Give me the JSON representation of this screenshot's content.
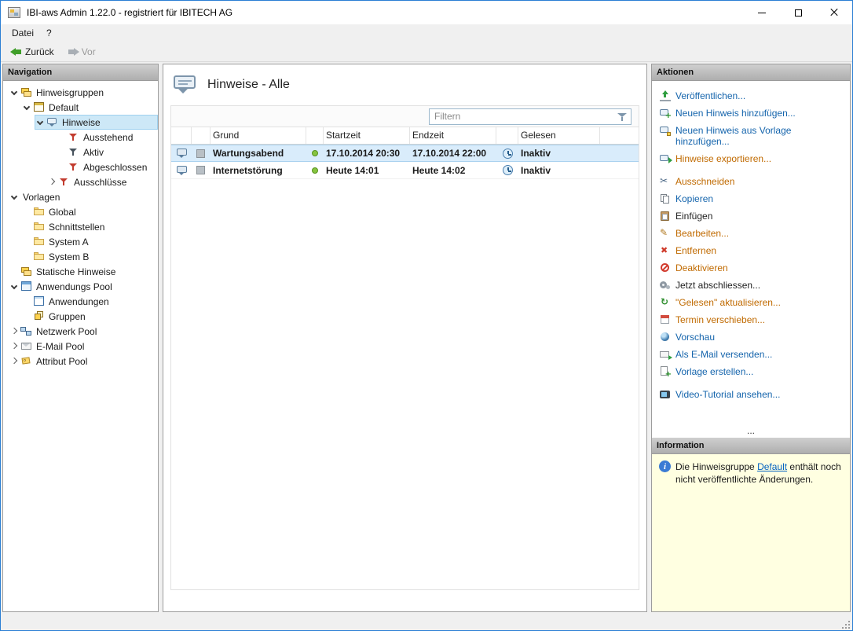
{
  "window": {
    "title": "IBI-aws Admin 1.22.0 - registriert für IBITECH AG"
  },
  "menu": {
    "items": [
      {
        "label": "Datei"
      },
      {
        "label": "?"
      }
    ]
  },
  "toolbar": {
    "back": "Zurück",
    "forward": "Vor"
  },
  "navigation": {
    "header": "Navigation",
    "tree": [
      {
        "label": "Hinweisgruppen",
        "icon": "layers-icon",
        "state": "expanded"
      },
      {
        "label": "Default",
        "icon": "group-window-icon",
        "state": "expanded"
      },
      {
        "label": "Hinweise",
        "icon": "speech-bubble-icon",
        "state": "expanded",
        "selected": true
      },
      {
        "label": "Ausstehend",
        "icon": "funnel-red-icon"
      },
      {
        "label": "Aktiv",
        "icon": "funnel-dark-icon"
      },
      {
        "label": "Abgeschlossen",
        "icon": "funnel-red-icon"
      },
      {
        "label": "Ausschlüsse",
        "icon": "funnel-red-icon",
        "state": "collapsed"
      },
      {
        "label": "Vorlagen",
        "icon": "",
        "state": "expanded"
      },
      {
        "label": "Global",
        "icon": "folder-icon"
      },
      {
        "label": "Schnittstellen",
        "icon": "folder-icon"
      },
      {
        "label": "System A",
        "icon": "folder-icon"
      },
      {
        "label": "System B",
        "icon": "folder-icon"
      },
      {
        "label": "Statische Hinweise",
        "icon": "layers-icon"
      },
      {
        "label": "Anwendungs Pool",
        "icon": "window-blue-icon",
        "state": "expanded"
      },
      {
        "label": "Anwendungen",
        "icon": "window-icon"
      },
      {
        "label": "Gruppen",
        "icon": "cube-icon"
      },
      {
        "label": "Netzwerk Pool",
        "icon": "network-icon",
        "state": "collapsed"
      },
      {
        "label": "E-Mail Pool",
        "icon": "mail-icon",
        "state": "collapsed"
      },
      {
        "label": "Attribut Pool",
        "icon": "tag-icon",
        "state": "collapsed"
      }
    ]
  },
  "main": {
    "title": "Hinweise - Alle",
    "filter_placeholder": "Filtern",
    "table": {
      "columns": [
        "Grund",
        "Startzeit",
        "Endzeit",
        "Gelesen"
      ],
      "rows": [
        {
          "grund": "Wartungsabend",
          "status": "green",
          "startzeit": "17.10.2014 20:30",
          "endzeit": "17.10.2014 22:00",
          "gelesen": "Inaktiv",
          "selected": true
        },
        {
          "grund": "Internetstörung",
          "status": "green",
          "startzeit": "Heute 14:01",
          "endzeit": "Heute 14:02",
          "gelesen": "Inaktiv",
          "selected": false
        }
      ]
    }
  },
  "actions": {
    "header": "Aktionen",
    "overflow": "...",
    "items": [
      {
        "label": "Veröffentlichen...",
        "icon": "publish-icon",
        "color": "blue"
      },
      {
        "label": "Neuen Hinweis hinzufügen...",
        "icon": "note-add-icon",
        "color": "blue"
      },
      {
        "label": "Neuen Hinweis aus Vorlage hinzufügen...",
        "icon": "note-template-icon",
        "color": "blue"
      },
      {
        "label": "Hinweise exportieren...",
        "icon": "note-export-icon",
        "color": "orange"
      },
      {
        "label": "Ausschneiden",
        "icon": "scissors-icon",
        "color": "orange"
      },
      {
        "label": "Kopieren",
        "icon": "copy-icon",
        "color": "blue"
      },
      {
        "label": "Einfügen",
        "icon": "paste-icon",
        "color": "black"
      },
      {
        "label": "Bearbeiten...",
        "icon": "edit-icon",
        "color": "orange"
      },
      {
        "label": "Entfernen",
        "icon": "remove-icon",
        "color": "orange"
      },
      {
        "label": "Deaktivieren",
        "icon": "deactivate-icon",
        "color": "orange"
      },
      {
        "label": "Jetzt abschliessen...",
        "icon": "finish-icon",
        "color": "black"
      },
      {
        "label": "\"Gelesen\" aktualisieren...",
        "icon": "refresh-icon",
        "color": "orange"
      },
      {
        "label": "Termin verschieben...",
        "icon": "calendar-icon",
        "color": "orange"
      },
      {
        "label": "Vorschau",
        "icon": "preview-icon",
        "color": "blue"
      },
      {
        "label": "Als E-Mail versenden...",
        "icon": "mail-send-icon",
        "color": "blue"
      },
      {
        "label": "Vorlage erstellen...",
        "icon": "template-new-icon",
        "color": "blue"
      },
      {
        "label": "Video-Tutorial ansehen...",
        "icon": "video-icon",
        "color": "blue"
      }
    ]
  },
  "information": {
    "header": "Information",
    "text_before": "Die Hinweisgruppe ",
    "link": "Default",
    "text_after": " enthält noch nicht veröffentlichte Änderungen."
  },
  "colors": {
    "accent_blue": "#1464ac",
    "action_orange": "#c06a00",
    "link_blue": "#0563c1",
    "selection_blue": "#d9ecfb",
    "info_bg": "#ffffe1"
  }
}
